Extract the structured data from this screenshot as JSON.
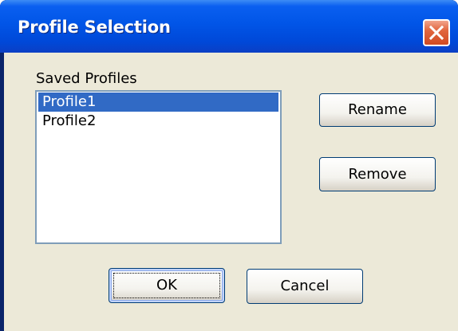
{
  "window": {
    "title": "Profile Selection"
  },
  "profiles": {
    "label": "Saved Profiles",
    "items": [
      "Profile1",
      "Profile2"
    ],
    "selected_index": 0
  },
  "buttons": {
    "rename": "Rename",
    "remove": "Remove",
    "ok": "OK",
    "cancel": "Cancel"
  },
  "icons": {
    "close": "close-icon"
  },
  "colors": {
    "titlebar": "#0155e7",
    "selection": "#316ac5",
    "close_button": "#e2673f",
    "dialog_background": "#ece9d8"
  }
}
